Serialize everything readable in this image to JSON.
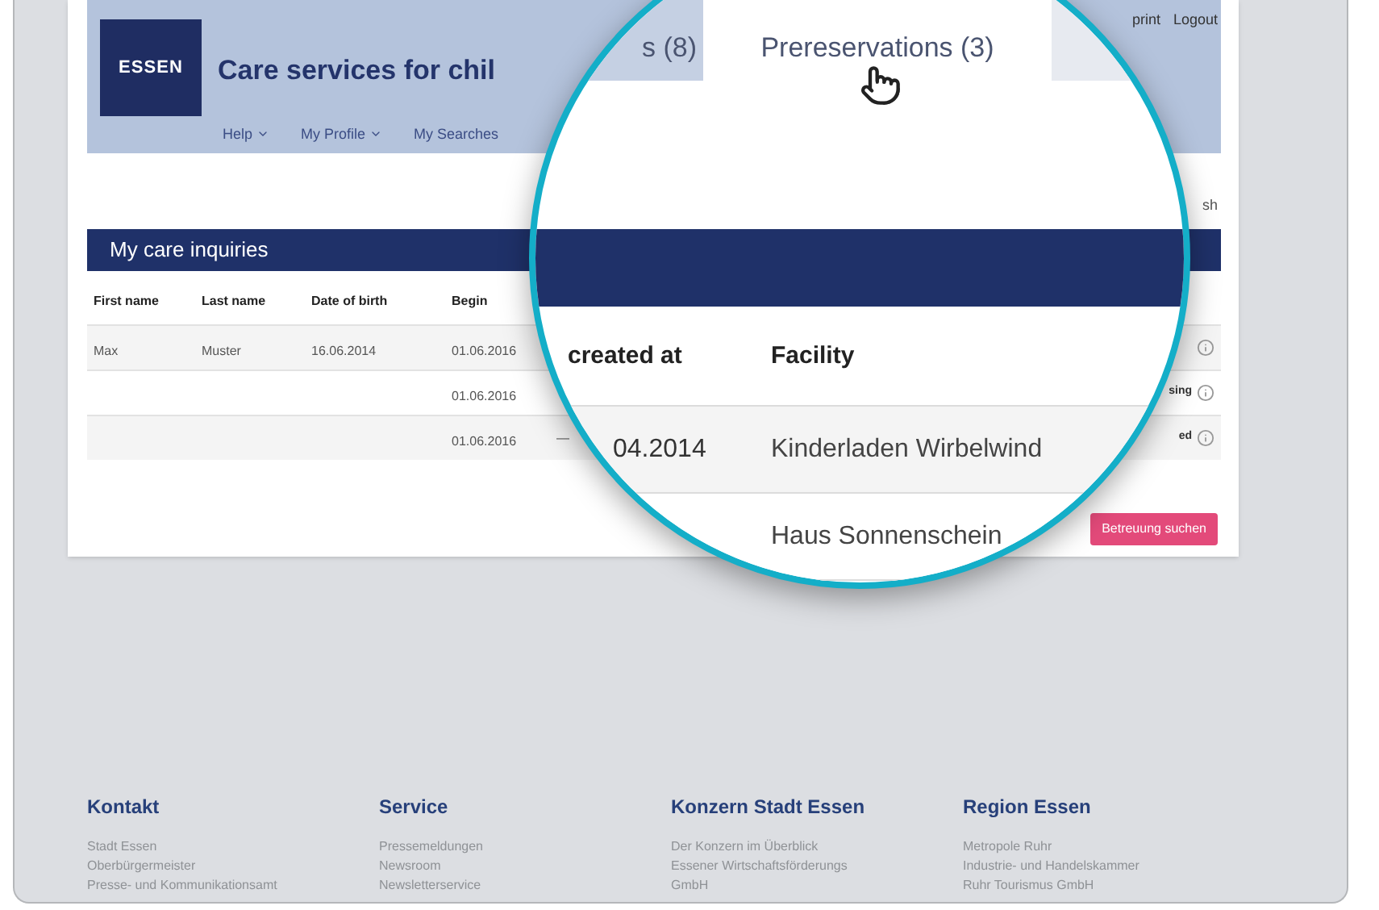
{
  "header": {
    "logo": "ESSEN",
    "title": "Care services for chil",
    "nav": [
      {
        "label": "Help",
        "dropdown": true
      },
      {
        "label": "My Profile",
        "dropdown": true
      },
      {
        "label": "My Searches",
        "dropdown": false
      }
    ],
    "top_links": [
      "print",
      "Logout"
    ]
  },
  "side_link": "sh",
  "panel": {
    "title": "My care inquiries",
    "columns": [
      "First name",
      "Last name",
      "Date of birth",
      "Begin"
    ],
    "rows": [
      {
        "cells": [
          "Max",
          "Muster",
          "16.06.2014",
          "01.06.2016"
        ]
      },
      {
        "cells": [
          "",
          "",
          "",
          "01.06.2016"
        ],
        "status": "sing"
      },
      {
        "cells": [
          "",
          "",
          "",
          "01.06.2016"
        ],
        "dash": "—",
        "status": "ed"
      }
    ],
    "button": "Betreuung suchen"
  },
  "magnifier": {
    "tabs": [
      {
        "label": "s (8)",
        "selected": false
      },
      {
        "label": "Prereservations (3)",
        "selected": true
      }
    ],
    "columns": [
      "created at",
      "Facility"
    ],
    "rows": [
      {
        "created_at": "04.2014",
        "facility": "Kinderladen Wirbelwind"
      },
      {
        "facility": "Haus Sonnenschein"
      }
    ]
  },
  "footer": [
    {
      "heading": "Kontakt",
      "links": [
        "Stadt Essen",
        "Oberbürgermeister",
        "Presse- und Kommunikationsamt"
      ]
    },
    {
      "heading": "Service",
      "links": [
        "Pressemeldungen",
        "Newsroom",
        "Newsletterservice"
      ]
    },
    {
      "heading": "Konzern Stadt Essen",
      "links": [
        "Der Konzern im Überblick",
        "Essener Wirtschaftsförderungs",
        "GmbH"
      ]
    },
    {
      "heading": "Region Essen",
      "links": [
        "Metropole Ruhr",
        "Industrie- und Handelskammer",
        "Ruhr Tourismus GmbH"
      ]
    }
  ]
}
